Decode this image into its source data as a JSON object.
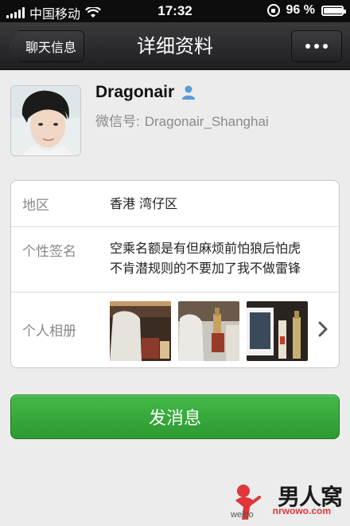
{
  "status_bar": {
    "carrier": "中国移动",
    "time": "17:32",
    "battery": "96 %",
    "battery_level": 0.96
  },
  "nav": {
    "back_label": "聊天信息",
    "title": "详细资料"
  },
  "profile": {
    "name": "Dragonair",
    "wechat_id_label": "微信号:",
    "wechat_id": "Dragonair_Shanghai"
  },
  "info": {
    "region_label": "地区",
    "region_value": "香港 湾仔区",
    "signature_label": "个性签名",
    "signature_line1": "空乘名额是有但麻烦前怕狼后怕虎",
    "signature_line2": "不肯潜规则的不要加了我不做雷锋",
    "album_label": "个人相册"
  },
  "actions": {
    "send_label": "发消息"
  },
  "watermark": {
    "logo_text": "男人窝",
    "site": "nrwowo.com",
    "weibo": "weibo"
  },
  "colors": {
    "nav_bg": "#2a2a2e",
    "accent_green": "#36a93b",
    "page_bg": "#ececec"
  }
}
